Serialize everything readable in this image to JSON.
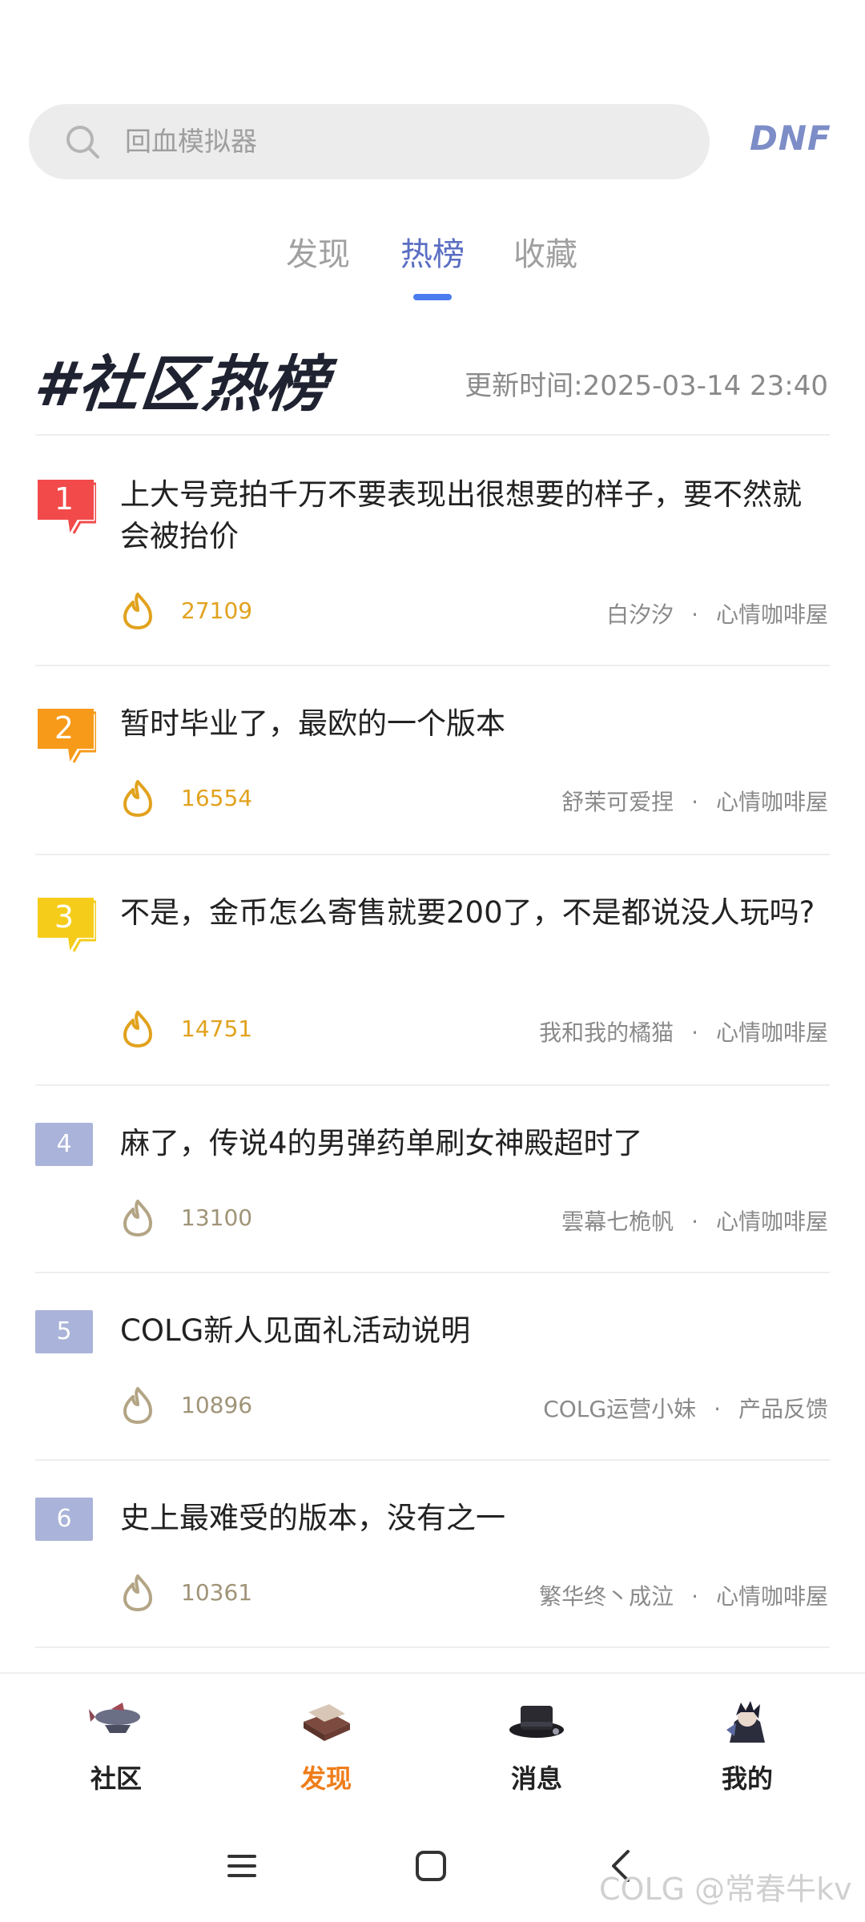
{
  "search": {
    "placeholder": "回血模拟器"
  },
  "brand": {
    "logo_text": "DNF"
  },
  "tabs": [
    {
      "label": "发现",
      "active": false
    },
    {
      "label": "热榜",
      "active": true
    },
    {
      "label": "收藏",
      "active": false
    }
  ],
  "section": {
    "title": "#社区热榜",
    "update_time": "更新时间:2025-03-14 23:40"
  },
  "colors": {
    "accent_blue": "#4a7cf0",
    "tab_active": "#5a6ec2",
    "rank_1": "#f24a4a",
    "rank_2": "#f79a1a",
    "rank_3": "#f5cc1a",
    "rank_default": "#aab3d9",
    "heat_hot": "#e1a21d",
    "nav_active": "#ef7d1a"
  },
  "items": [
    {
      "rank": "1",
      "title": "上大号竞拍千万不要表现出很想要的样子，要不然就会被抬价",
      "heat": "27109",
      "author": "白汐汐",
      "board": "心情咖啡屋",
      "dot": "·"
    },
    {
      "rank": "2",
      "title": "暂时毕业了，最欧的一个版本",
      "heat": "16554",
      "author": "舒茉可爱捏",
      "board": "心情咖啡屋",
      "dot": "·"
    },
    {
      "rank": "3",
      "title": "不是，金币怎么寄售就要200了，不是都说没人玩吗?",
      "heat": "14751",
      "author": "我和我的橘猫",
      "board": "心情咖啡屋",
      "dot": "·"
    },
    {
      "rank": "4",
      "title": "麻了，传说4的男弹药单刷女神殿超时了",
      "heat": "13100",
      "author": "雲幕七桅帆",
      "board": "心情咖啡屋",
      "dot": "·"
    },
    {
      "rank": "5",
      "title": "COLG新人见面礼活动说明",
      "heat": "10896",
      "author": "COLG运营小妹",
      "board": "产品反馈",
      "dot": "·"
    },
    {
      "rank": "6",
      "title": "史上最难受的版本，没有之一",
      "heat": "10361",
      "author": "繁华终丶成泣",
      "board": "心情咖啡屋",
      "dot": "·"
    }
  ],
  "bottom_nav": [
    {
      "label": "社区",
      "icon": "airship-icon",
      "active": false
    },
    {
      "label": "发现",
      "icon": "book-icon",
      "active": true
    },
    {
      "label": "消息",
      "icon": "top-hat-icon",
      "active": false
    },
    {
      "label": "我的",
      "icon": "avatar-icon",
      "active": false
    }
  ],
  "watermark": "COLG @常春牛kv"
}
